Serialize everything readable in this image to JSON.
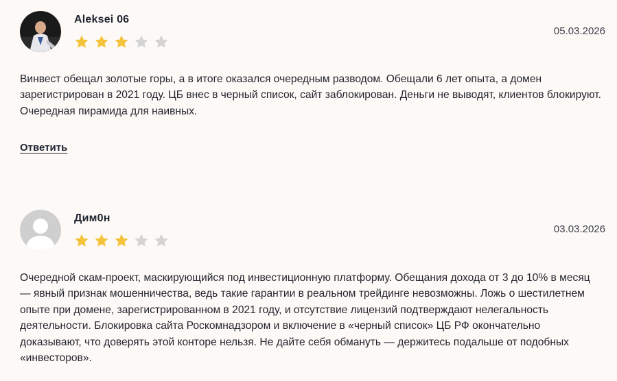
{
  "reviews": [
    {
      "author": "Aleksei 06",
      "date": "05.03.2026",
      "rating": 3,
      "max_rating": 5,
      "text": "Винвест обещал золотые горы, а в итоге оказался очередным разводом. Обещали 6 лет опыта, а домен зарегистрирован в 2021 году. ЦБ внес в черный список, сайт заблокирован. Деньги не выводят, клиентов блокируют. Очередная пирамида для наивных.",
      "reply_label": "Ответить",
      "avatar": "user-photo"
    },
    {
      "author": "Дим0н",
      "date": "03.03.2026",
      "rating": 3,
      "max_rating": 5,
      "text": "Очередной скам-проект, маскирующийся под инвестиционную платформу. Обещания дохода от 3 до 10% в месяц — явный признак мошенничества, ведь такие гарантии в реальном трейдинге невозможны. Ложь о шестилетнем опыте при домене, зарегистрированном в 2021 году, и отсутствие лицензий подтверждают нелегальность деятельности. Блокировка сайта Роскомнадзором и включение в «черный список» ЦБ РФ окончательно доказывают, что доверять этой конторе нельзя. Не дайте себя обмануть — держитесь подальше от подобных «инвесторов».",
      "avatar": "default-user-icon"
    }
  ],
  "colors": {
    "star_filled": "#f5c33b",
    "star_empty": "#d4d4d4",
    "background": "#fdf9f6"
  }
}
